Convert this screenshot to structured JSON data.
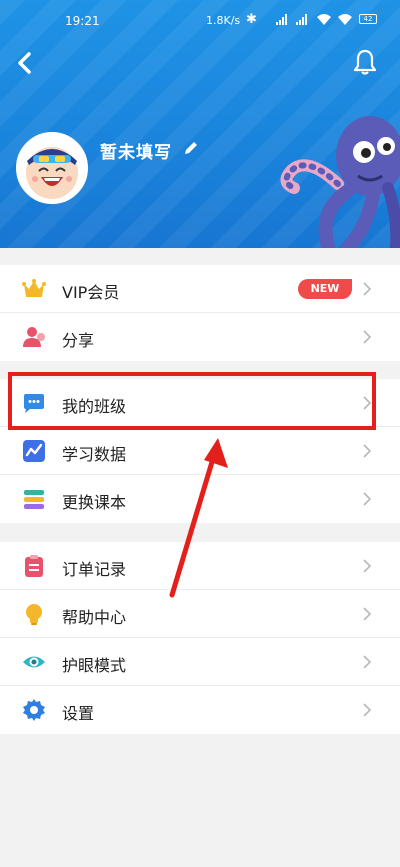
{
  "status_bar": {
    "time": "19:21",
    "network_speed": "1.8K/s",
    "battery": "42"
  },
  "profile": {
    "nickname": "暂未填写"
  },
  "menu": {
    "group1": [
      {
        "label": "VIP会员",
        "icon": "crown-icon",
        "badge": "NEW"
      },
      {
        "label": "分享",
        "icon": "share-user-icon"
      }
    ],
    "group2": [
      {
        "label": "我的班级",
        "icon": "chat-bubble-icon"
      },
      {
        "label": "学习数据",
        "icon": "chart-icon"
      },
      {
        "label": "更换课本",
        "icon": "books-icon"
      }
    ],
    "group3": [
      {
        "label": "订单记录",
        "icon": "clipboard-icon"
      },
      {
        "label": "帮助中心",
        "icon": "lightbulb-icon"
      },
      {
        "label": "护眼模式",
        "icon": "eye-icon"
      },
      {
        "label": "设置",
        "icon": "gear-icon"
      }
    ]
  },
  "colors": {
    "header": "#1a83db",
    "highlight": "#e3201b",
    "badge": "#f04a4a"
  }
}
